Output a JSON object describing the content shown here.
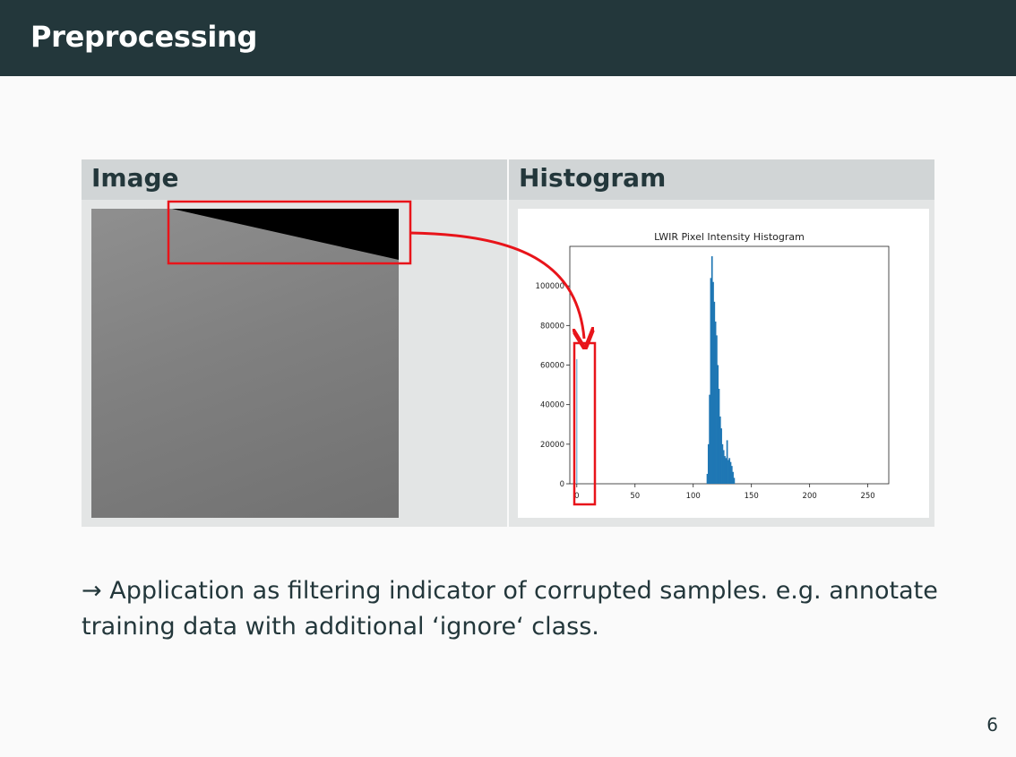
{
  "slide": {
    "title": "Preprocessing",
    "page_number": "6"
  },
  "table": {
    "headers": [
      "Image",
      "Histogram"
    ]
  },
  "body": {
    "arrow": "→",
    "text": "Application as filtering indicator of corrupted samples. e.g. annotate training data with additional ‘ignore‘ class."
  },
  "colors": {
    "title_bar": "#23373b",
    "highlight": "#e8141a",
    "hist_bar": "#1f77b4"
  },
  "chart_data": {
    "type": "bar",
    "title": "LWIR Pixel Intensity Histogram",
    "xlabel": "",
    "ylabel": "",
    "xlim": [
      -6,
      268
    ],
    "ylim": [
      0,
      120000
    ],
    "xticks": [
      0,
      50,
      100,
      150,
      200,
      250
    ],
    "yticks": [
      0,
      20000,
      40000,
      60000,
      80000,
      100000
    ],
    "x": [
      0,
      112,
      113,
      114,
      115,
      116,
      117,
      118,
      119,
      120,
      121,
      122,
      123,
      124,
      125,
      126,
      127,
      128,
      129,
      130,
      131,
      132,
      133,
      134,
      135
    ],
    "values": [
      63000,
      5000,
      20000,
      45000,
      104000,
      115000,
      102000,
      92000,
      82000,
      75000,
      60000,
      48000,
      34000,
      28000,
      20000,
      17000,
      14000,
      13000,
      22000,
      12000,
      13000,
      11000,
      9000,
      6000,
      3000
    ]
  }
}
